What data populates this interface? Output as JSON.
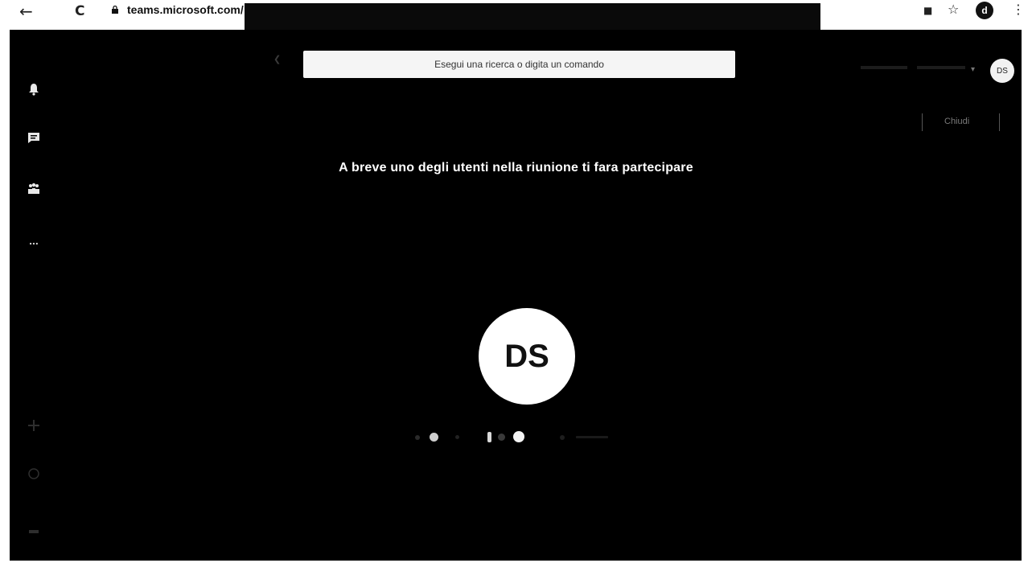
{
  "browser": {
    "back_glyph": "←",
    "reload_glyph": "C",
    "url_text": "teams.microsoft.com/",
    "profile_initial": "d",
    "star_glyph": "☆",
    "menu_glyph": "⋮",
    "ext_glyph": "■"
  },
  "header": {
    "search_placeholder": "Esegui una ricerca o digita un comando",
    "user_initials": "DS"
  },
  "sidebar": {
    "items": [
      {
        "icon": "bell-icon"
      },
      {
        "icon": "chat-icon"
      },
      {
        "icon": "teams-icon"
      },
      {
        "icon": "more-icon",
        "label": "..."
      }
    ]
  },
  "call": {
    "close_label": "Chiudi",
    "waiting_message": "A breve uno degli utenti nella riunione ti fara partecipare",
    "avatar_initials": "DS"
  },
  "colors": {
    "background": "#000000",
    "text": "#ffffff"
  }
}
